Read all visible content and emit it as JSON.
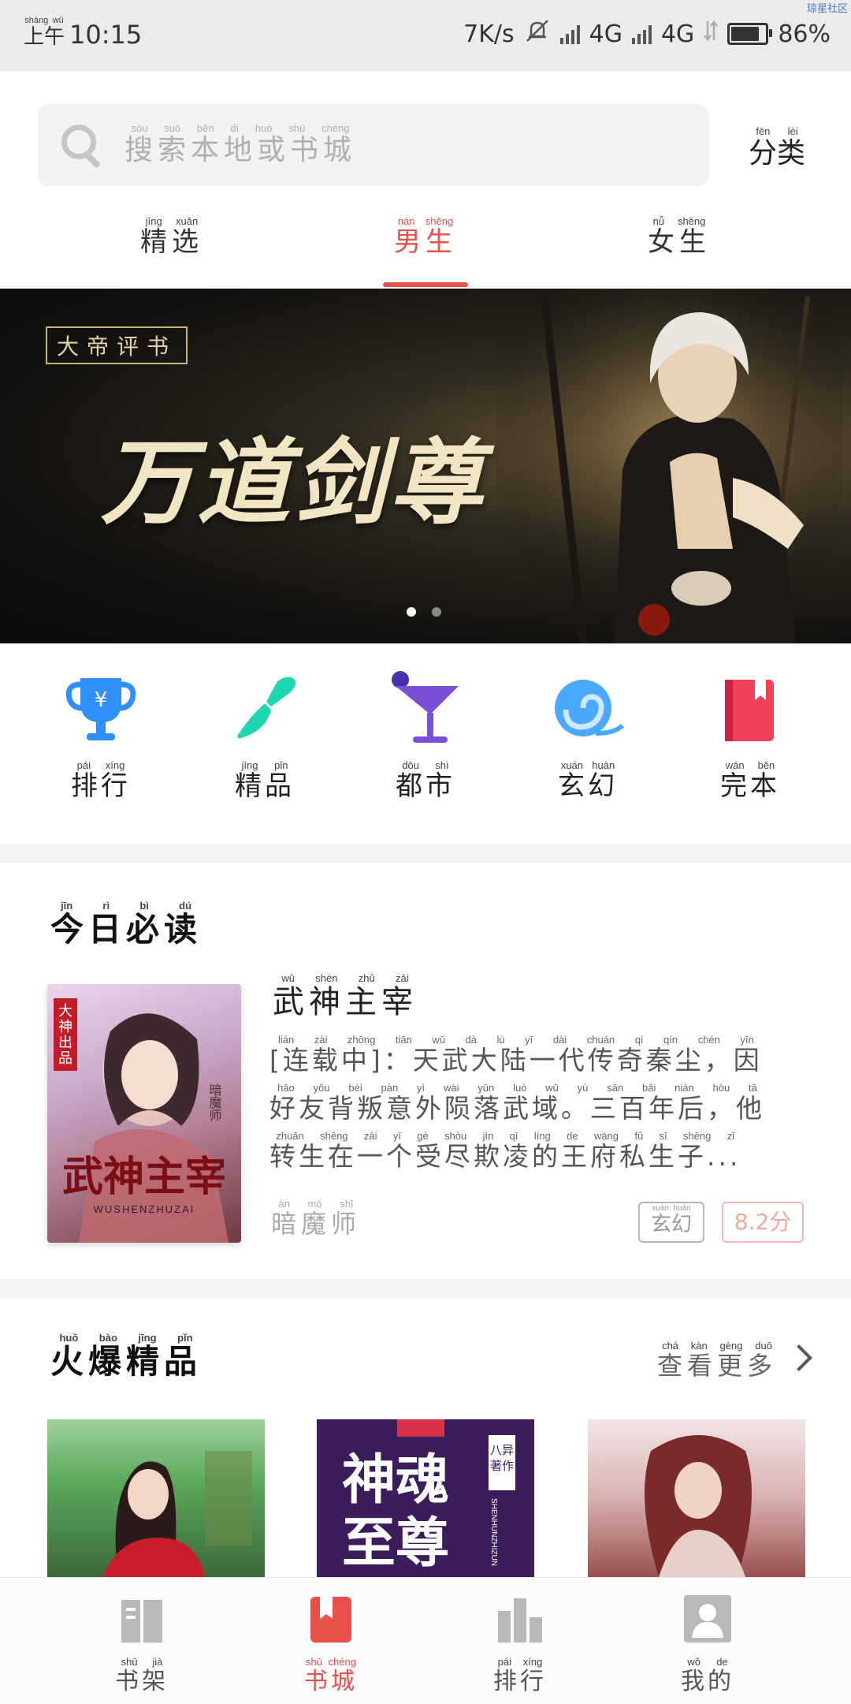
{
  "status_bar": {
    "ampm": "上午",
    "ampm_pinyin": "shàng wǔ",
    "time": "10:15",
    "net_speed": "7K/s",
    "net1": "4G",
    "net2": "4G",
    "battery": "86%",
    "battery_level": 0.86,
    "corner": "琼星社区",
    "icons": [
      "mute-icon",
      "signal-icon",
      "signal-icon",
      "data-arrows-icon",
      "battery-icon"
    ]
  },
  "search": {
    "placeholder": "搜索本地或书城",
    "placeholder_pinyin": "sōu suǒ běn dì huò shū chéng"
  },
  "classify": {
    "label": "分类",
    "pinyin": "fēn lèi"
  },
  "tabs": [
    {
      "label": "精选",
      "pinyin": "jīng xuǎn",
      "active": false
    },
    {
      "label": "男生",
      "pinyin": "nán shēng",
      "active": true
    },
    {
      "label": "女生",
      "pinyin": "nǚ shēng",
      "active": false
    }
  ],
  "banner": {
    "tag": "大帝评书",
    "title": "万道剑尊",
    "page_count": 2,
    "active_page": 1
  },
  "categories": [
    {
      "label": "排行",
      "pinyin": "pái xíng",
      "icon": "trophy-icon",
      "color": "#2f8fff"
    },
    {
      "label": "精品",
      "pinyin": "jīng pǐn",
      "icon": "brush-icon",
      "color": "#1ed6b0"
    },
    {
      "label": "都市",
      "pinyin": "dōu shì",
      "icon": "cocktail-icon",
      "color": "#7a4fd8"
    },
    {
      "label": "玄幻",
      "pinyin": "xuán huàn",
      "icon": "swirl-icon",
      "color": "#4aa8ff"
    },
    {
      "label": "完本",
      "pinyin": "wán běn",
      "icon": "book-icon",
      "color": "#f0405a"
    }
  ],
  "today": {
    "title": "今日必读",
    "title_pinyin": "jīn rì bì dú",
    "book": {
      "name": "武神主宰",
      "name_pinyin": "wǔ shén zhǔ zǎi",
      "desc_line1": "[连载中]：天武大陆一代传奇秦尘，因",
      "desc_line1_pinyin": "lián zài zhōng tiān wǔ dà lù yī dài chuán qí qín chén yīn",
      "desc_line2": "好友背叛意外陨落武域。三百年后，他",
      "desc_line2_pinyin": "hǎo yǒu bèi pàn yì wài yǔn luò wǔ yù sān bǎi nián hòu tā",
      "desc_line3": "转生在一个受尽欺凌的王府私生子...",
      "desc_line3_pinyin": "zhuǎn shēng zài yī gè shòu jìn qī líng de wáng fǔ sī shēng zǐ",
      "author": "暗魔师",
      "author_pinyin": "àn mó shī",
      "genre": "玄幻",
      "genre_pinyin": "xuán huàn",
      "score": "8.2分",
      "cover_text": "武神主宰",
      "cover_sub": "WUSHENZHUZAI",
      "cover_side": "大神出品",
      "cover_author": "暗魔师"
    }
  },
  "hot": {
    "title": "火爆精品",
    "title_pinyin": "huǒ bào jīng pǐn",
    "more": "查看更多",
    "more_pinyin": "chá kàn gèng duō",
    "covers": [
      {
        "text": ""
      },
      {
        "text": "神魂至尊",
        "side": "八异著作",
        "sub": "SHENHUNZHIZUN"
      },
      {
        "text": ""
      }
    ]
  },
  "bottom_nav": [
    {
      "label": "书架",
      "pinyin": "shū jià",
      "icon": "bookshelf-icon",
      "active": false
    },
    {
      "label": "书城",
      "pinyin": "shū chéng",
      "icon": "bookmark-icon",
      "active": true
    },
    {
      "label": "排行",
      "pinyin": "pái xíng",
      "icon": "bar-chart-icon",
      "active": false
    },
    {
      "label": "我的",
      "pinyin": "wǒ de",
      "icon": "profile-icon",
      "active": false
    }
  ]
}
